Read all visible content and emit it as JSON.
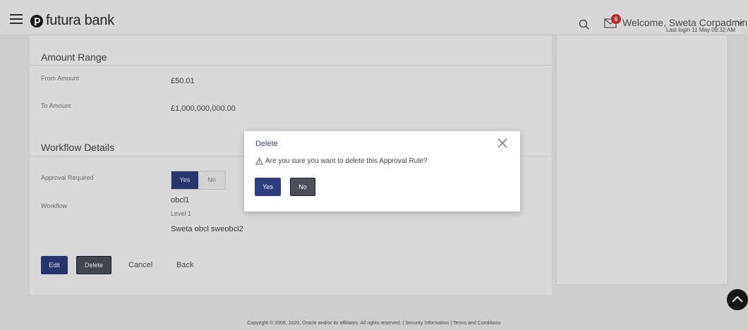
{
  "header": {
    "brand": "futura bank",
    "mail_count": "6",
    "welcome": "Welcome, Sweta Corpadmin",
    "last_login": "Last login 11 May 09:32 AM"
  },
  "amount_range": {
    "title": "Amount Range",
    "from_label": "From Amount",
    "from_value": "£50.01",
    "to_label": "To Amount",
    "to_value": "£1,000,000,000.00"
  },
  "workflow": {
    "title": "Workflow Details",
    "approval_label": "Approval Required",
    "toggle_yes": "Yes",
    "toggle_no": "No",
    "workflow_label": "Workflow",
    "workflow_name": "obcl1",
    "level": "Level 1",
    "approvers": "Sweta obcl sweobcl2"
  },
  "actions": {
    "edit": "Edit",
    "delete": "Delete",
    "cancel": "Cancel",
    "back": "Back"
  },
  "modal": {
    "title": "Delete",
    "message": "Are you sure you want to delete this Approval Rule?",
    "yes": "Yes",
    "no": "No"
  },
  "footer": {
    "text": "Copyright © 2006, 2020, Oracle and/or its affiliates. All rights reserved. | Security Information | Terms and Conditions"
  },
  "colors": {
    "primary": "#2d3d7e",
    "badge": "#d32f2f",
    "dark_button": "#4a4f59"
  }
}
